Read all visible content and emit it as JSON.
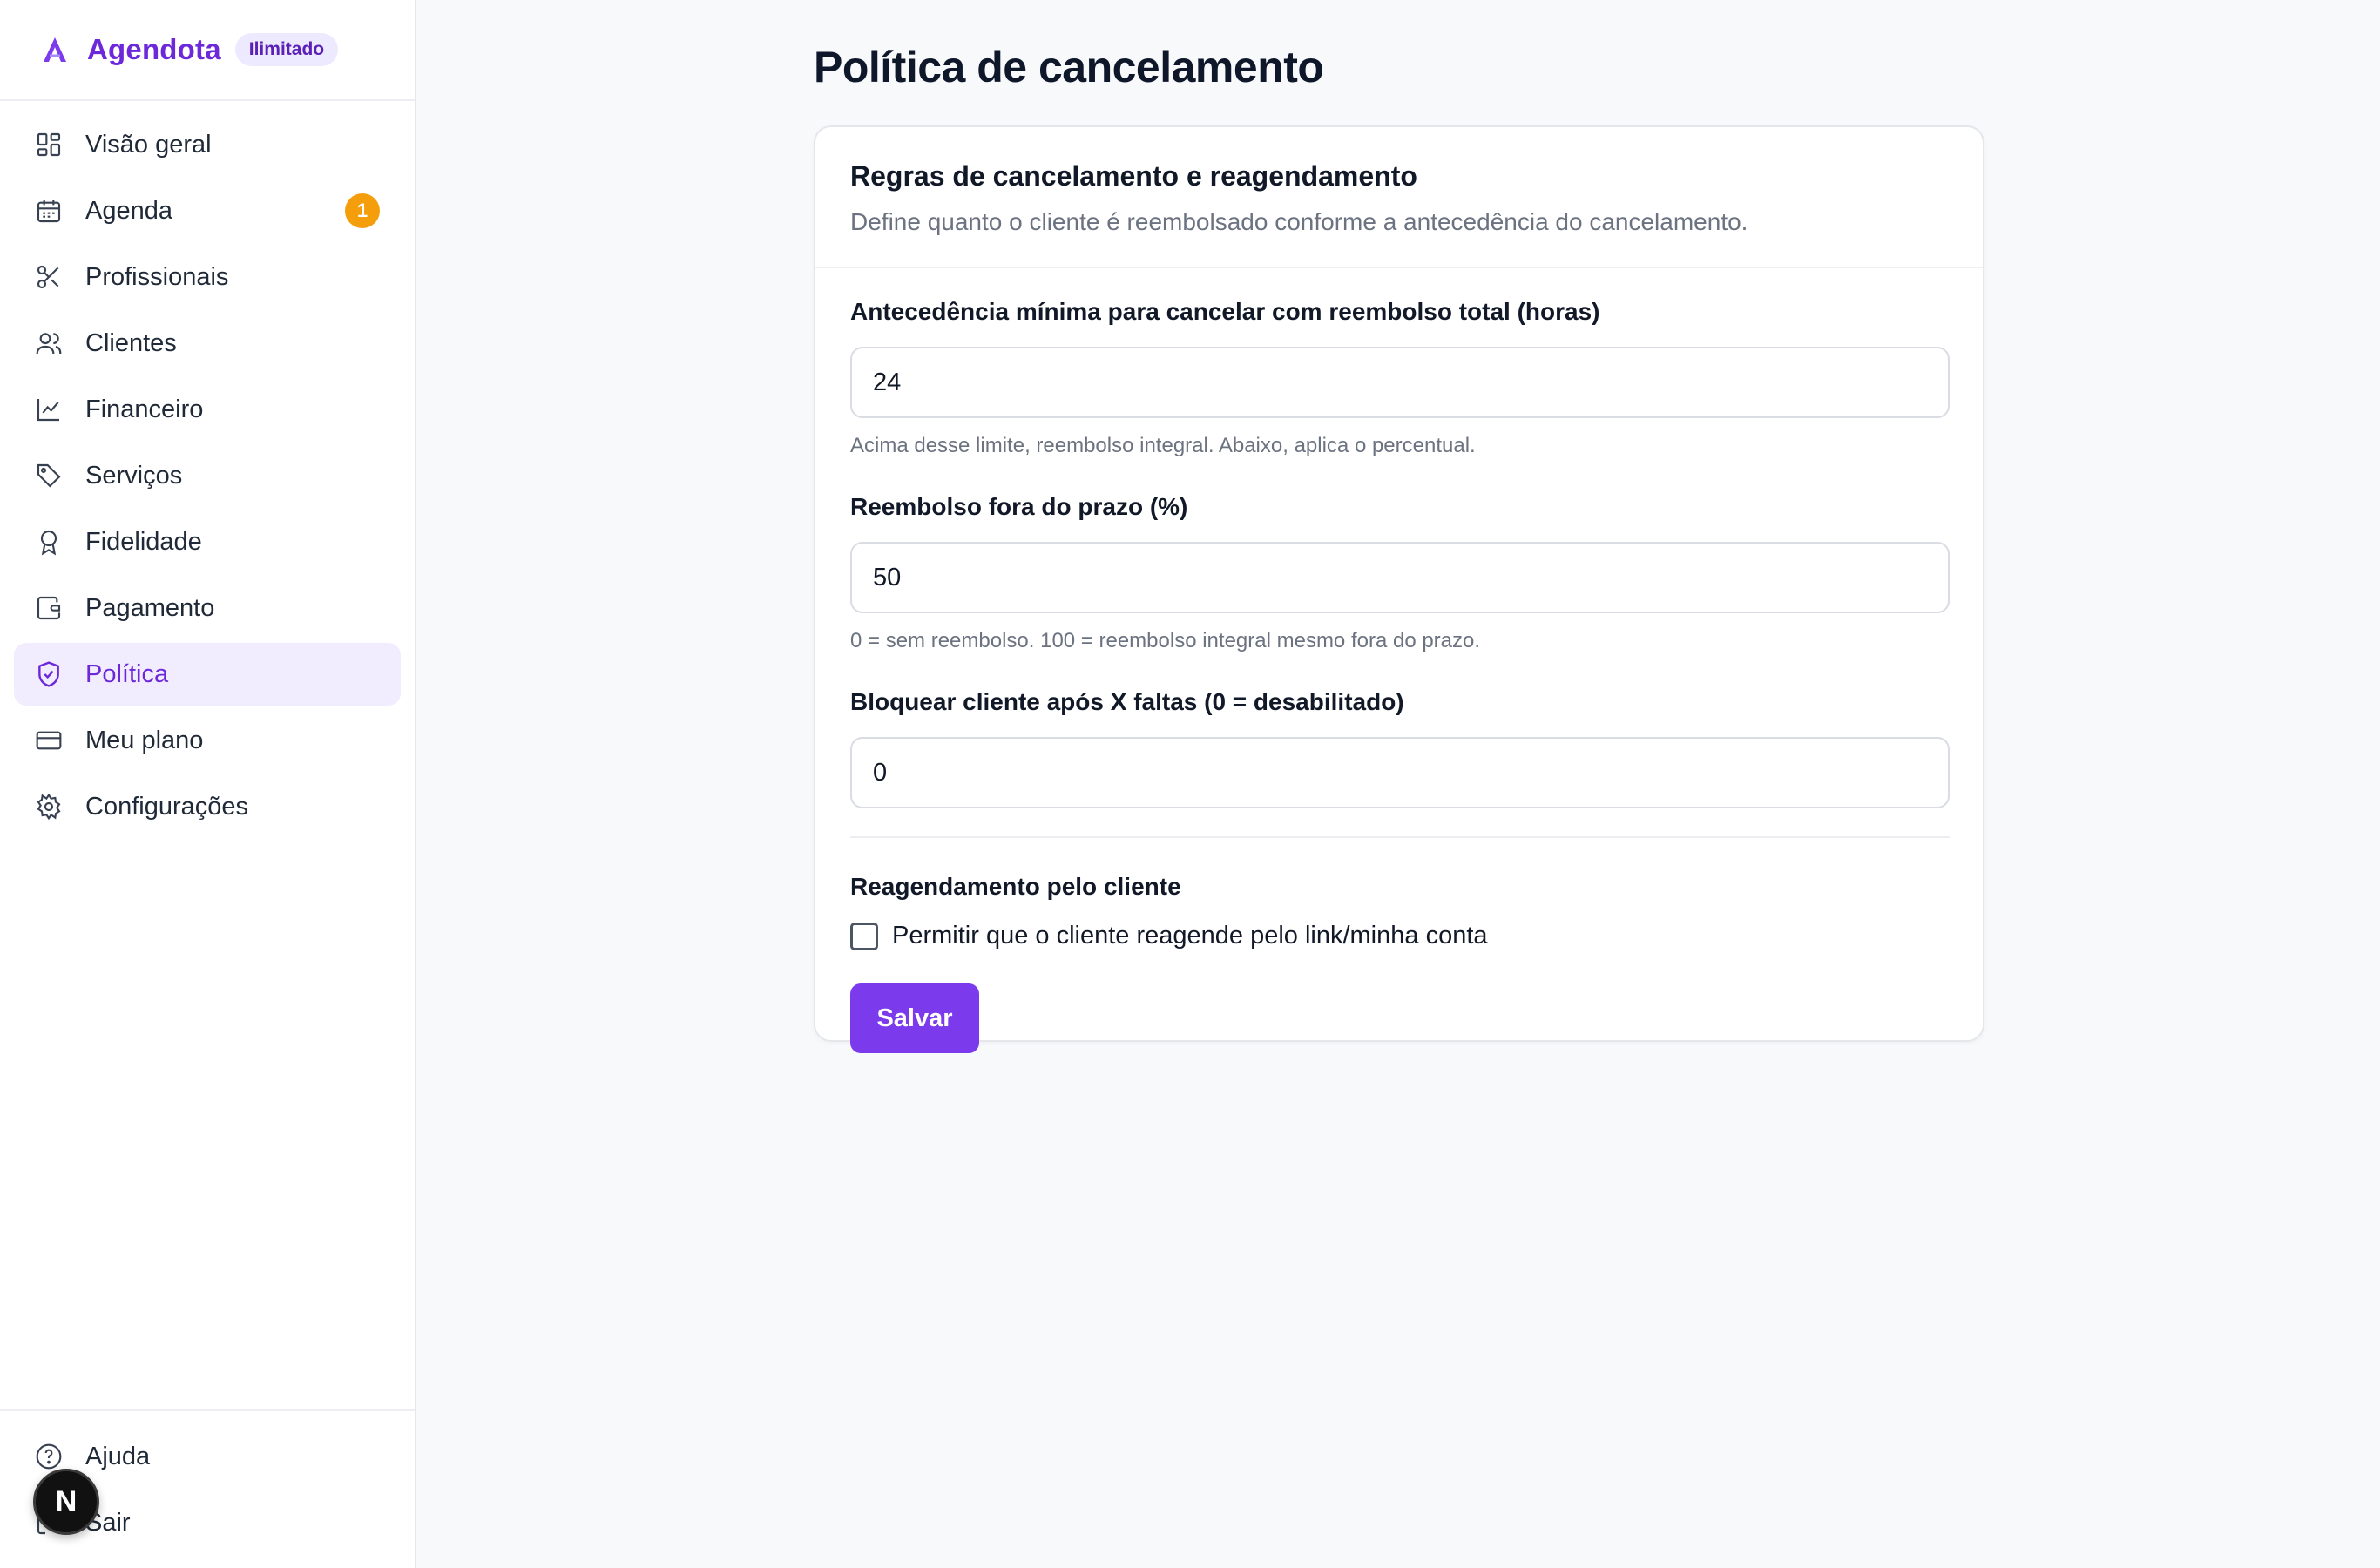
{
  "brand": {
    "name": "Agendota",
    "badge": "Ilimitado"
  },
  "sidebar": {
    "items": [
      {
        "label": "Visão geral",
        "icon": "dashboard-icon"
      },
      {
        "label": "Agenda",
        "icon": "calendar-icon",
        "badge": "1"
      },
      {
        "label": "Profissionais",
        "icon": "scissors-icon"
      },
      {
        "label": "Clientes",
        "icon": "users-icon"
      },
      {
        "label": "Financeiro",
        "icon": "chart-line-icon"
      },
      {
        "label": "Serviços",
        "icon": "tag-icon"
      },
      {
        "label": "Fidelidade",
        "icon": "award-icon"
      },
      {
        "label": "Pagamento",
        "icon": "wallet-icon"
      },
      {
        "label": "Política",
        "icon": "shield-check-icon",
        "active": true
      },
      {
        "label": "Meu plano",
        "icon": "credit-card-icon"
      },
      {
        "label": "Configurações",
        "icon": "gear-icon"
      }
    ],
    "bottom": [
      {
        "label": "Ajuda",
        "icon": "help-circle-icon"
      },
      {
        "label": "Sair",
        "icon": "logout-icon"
      }
    ],
    "dev_badge": "N"
  },
  "main": {
    "title": "Política de cancelamento",
    "card": {
      "title": "Regras de cancelamento e reagendamento",
      "description": "Define quanto o cliente é reembolsado conforme a antecedência do cancelamento.",
      "fields": [
        {
          "label": "Antecedência mínima para cancelar com reembolso total (horas)",
          "value": "24",
          "hint": "Acima desse limite, reembolso integral. Abaixo, aplica o percentual."
        },
        {
          "label": "Reembolso fora do prazo (%)",
          "value": "50",
          "hint": "0 = sem reembolso. 100 = reembolso integral mesmo fora do prazo."
        },
        {
          "label": "Bloquear cliente após X faltas (0 = desabilitado)",
          "value": "0"
        }
      ],
      "reschedule": {
        "title": "Reagendamento pelo cliente",
        "checkbox_label": "Permitir que o cliente reagende pelo link/minha conta",
        "checked": false
      },
      "save_label": "Salvar"
    }
  },
  "colors": {
    "accent": "#7c3aed",
    "accent_text": "#6d28d9",
    "active_bg": "#f1edfe",
    "badge_orange": "#f59e0b"
  }
}
